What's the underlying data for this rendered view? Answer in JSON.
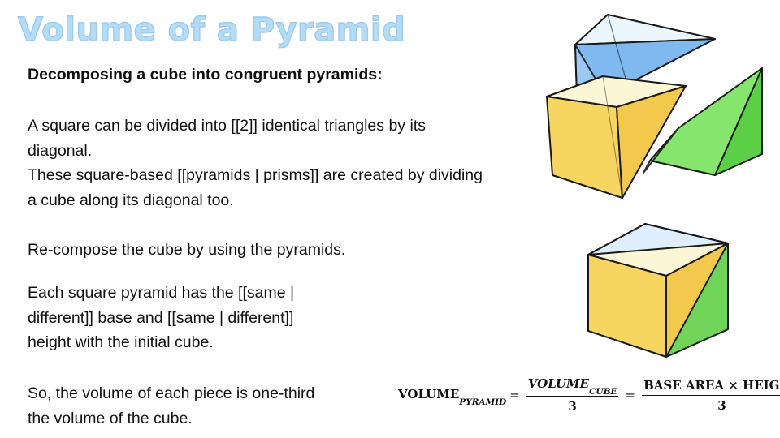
{
  "title": "Volume of a Pyramid",
  "subheading": "Decomposing a cube into congruent pyramids:",
  "paragraph1": {
    "line1": "A square can be divided into [[2]] identical triangles by its",
    "line2": "diagonal.",
    "line3": "These square-based [[pyramids | prisms]] are created by dividing",
    "line4": "a cube along its diagonal too."
  },
  "paragraph2": "Re-compose the cube by using the pyramids.",
  "paragraph3": {
    "line1": "Each square pyramid has the [[same |",
    "line2": "different]] base and [[same | different]]",
    "line3": "height with the initial cube."
  },
  "paragraph4": {
    "line1": "So, the volume of each piece is one-third",
    "line2": "the volume of the cube."
  },
  "formula": {
    "lhs": "VOLUME",
    "lhs_sub": "PYRAMID",
    "eq": "=",
    "frac1_num": "VOLUME",
    "frac1_num_sub": "CUBE",
    "frac1_den": "3",
    "frac2_num": "BASE AREA × HEIGHT",
    "frac2_den": "3"
  },
  "colors": {
    "blue_face": "#7fb8f0",
    "yellow_face": "#f7d561",
    "green_face": "#72dc5c",
    "title": "#b4dcf6"
  }
}
